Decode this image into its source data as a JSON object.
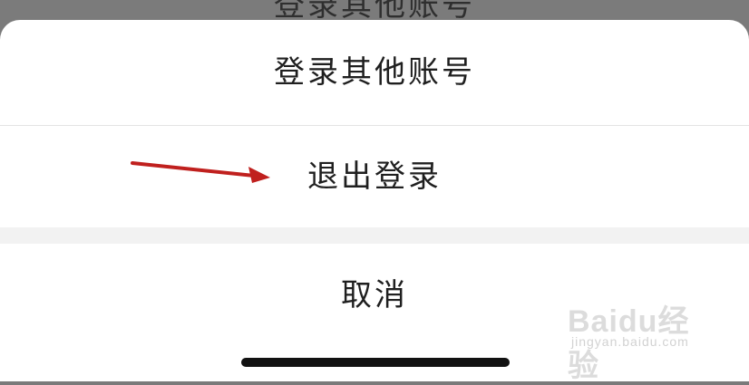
{
  "background": {
    "text": "登录其他账号"
  },
  "sheet": {
    "options": [
      {
        "label": "登录其他账号"
      },
      {
        "label": "退出登录"
      }
    ],
    "cancel_label": "取消"
  },
  "watermark": {
    "brand": "Baidu经验",
    "url": "jingyan.baidu.com"
  },
  "annotation": {
    "arrow_color": "#c0201e"
  }
}
